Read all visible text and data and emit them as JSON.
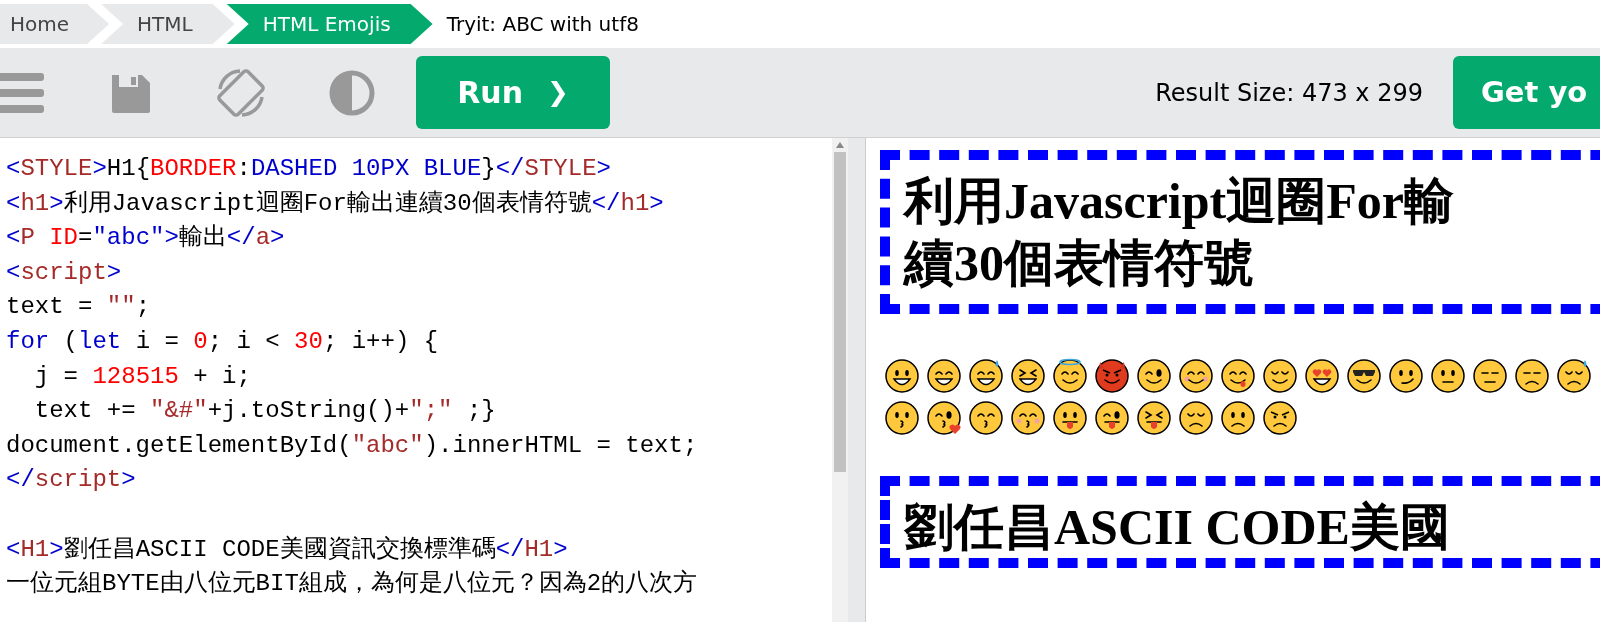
{
  "breadcrumbs": [
    {
      "label": "Home",
      "selected": false
    },
    {
      "label": "HTML",
      "selected": false
    },
    {
      "label": "HTML Emojis",
      "selected": true
    }
  ],
  "page_title": "Tryit: ABC with utf8",
  "toolbar": {
    "run_button": "Run",
    "run_icon": "❯",
    "result_size": "Result Size: 473 x 299",
    "get_button": "Get yo"
  },
  "code_lines": [
    {
      "tokens": [
        {
          "text": "<",
          "kind": "tag"
        },
        {
          "text": "STYLE",
          "kind": "name"
        },
        {
          "text": ">",
          "kind": "tag"
        },
        {
          "text": "H1{",
          "kind": "plain"
        },
        {
          "text": "BORDER",
          "kind": "attr"
        },
        {
          "text": ":",
          "kind": "plain"
        },
        {
          "text": "DASHED 10PX BLUE",
          "kind": "value"
        },
        {
          "text": "}",
          "kind": "plain"
        },
        {
          "text": "</",
          "kind": "tag"
        },
        {
          "text": "STYLE",
          "kind": "name"
        },
        {
          "text": ">",
          "kind": "tag"
        }
      ]
    },
    {
      "tokens": [
        {
          "text": "<",
          "kind": "tag"
        },
        {
          "text": "h1",
          "kind": "name"
        },
        {
          "text": ">",
          "kind": "tag"
        },
        {
          "text": "利用Javascript迴圈For輸出連續30個表情符號",
          "kind": "plain"
        },
        {
          "text": "</",
          "kind": "tag"
        },
        {
          "text": "h1",
          "kind": "name"
        },
        {
          "text": ">",
          "kind": "tag"
        }
      ]
    },
    {
      "tokens": [
        {
          "text": "<",
          "kind": "tag"
        },
        {
          "text": "P ",
          "kind": "name"
        },
        {
          "text": "ID",
          "kind": "attr"
        },
        {
          "text": "=",
          "kind": "plain"
        },
        {
          "text": "\"abc\"",
          "kind": "value"
        },
        {
          "text": ">",
          "kind": "tag"
        },
        {
          "text": "輸出",
          "kind": "plain"
        },
        {
          "text": "</",
          "kind": "tag"
        },
        {
          "text": "a",
          "kind": "name"
        },
        {
          "text": ">",
          "kind": "tag"
        }
      ]
    },
    {
      "tokens": [
        {
          "text": "<",
          "kind": "tag"
        },
        {
          "text": "script",
          "kind": "name"
        },
        {
          "text": ">",
          "kind": "tag"
        }
      ]
    },
    {
      "tokens": [
        {
          "text": "text = ",
          "kind": "plain"
        },
        {
          "text": "\"\"",
          "kind": "string"
        },
        {
          "text": ";",
          "kind": "plain"
        }
      ]
    },
    {
      "tokens": [
        {
          "text": "for",
          "kind": "keyword"
        },
        {
          "text": " (",
          "kind": "plain"
        },
        {
          "text": "let",
          "kind": "keyword"
        },
        {
          "text": " i = ",
          "kind": "plain"
        },
        {
          "text": "0",
          "kind": "number"
        },
        {
          "text": "; i < ",
          "kind": "plain"
        },
        {
          "text": "30",
          "kind": "number"
        },
        {
          "text": "; i++) {",
          "kind": "plain"
        }
      ]
    },
    {
      "tokens": [
        {
          "text": "  j = ",
          "kind": "plain"
        },
        {
          "text": "128515",
          "kind": "number"
        },
        {
          "text": " + i;",
          "kind": "plain"
        }
      ]
    },
    {
      "tokens": [
        {
          "text": "  text += ",
          "kind": "plain"
        },
        {
          "text": "\"&#\"",
          "kind": "string"
        },
        {
          "text": "+j.toString()+",
          "kind": "plain"
        },
        {
          "text": "\";\"",
          "kind": "string"
        },
        {
          "text": " ;}",
          "kind": "plain"
        }
      ]
    },
    {
      "tokens": [
        {
          "text": "document.getElementById(",
          "kind": "plain"
        },
        {
          "text": "\"abc\"",
          "kind": "string"
        },
        {
          "text": ").innerHTML = text;",
          "kind": "plain"
        }
      ]
    },
    {
      "tokens": [
        {
          "text": "</",
          "kind": "tag"
        },
        {
          "text": "script",
          "kind": "name"
        },
        {
          "text": ">",
          "kind": "tag"
        }
      ]
    },
    {
      "spaced": true,
      "tokens": [
        {
          "text": "<",
          "kind": "tag"
        },
        {
          "text": "H1",
          "kind": "name"
        },
        {
          "text": ">",
          "kind": "tag"
        },
        {
          "text": "劉任昌ASCII CODE美國資訊交換標準碼",
          "kind": "plain"
        },
        {
          "text": "</",
          "kind": "tag"
        },
        {
          "text": "H1",
          "kind": "name"
        },
        {
          "text": ">",
          "kind": "tag"
        }
      ]
    },
    {
      "tokens": [
        {
          "text": "一位元組BYTE由八位元BIT組成，為何是八位元？因為2的八次方",
          "kind": "plain"
        }
      ]
    }
  ],
  "result": {
    "heading_1": [
      "利用Javascript迴圈For輸",
      "續30個表情符號"
    ],
    "emoji_rows": [
      [
        {
          "kind": "grin"
        },
        {
          "kind": "smile"
        },
        {
          "kind": "sweat"
        },
        {
          "kind": "laugh"
        },
        {
          "kind": "halo"
        },
        {
          "kind": "devil"
        },
        {
          "kind": "wink"
        },
        {
          "kind": "blush"
        },
        {
          "kind": "yum"
        },
        {
          "kind": "relieved"
        },
        {
          "kind": "hearts"
        },
        {
          "kind": "sunglasses"
        },
        {
          "kind": "smirk"
        },
        {
          "kind": "neutral"
        },
        {
          "kind": "expressionless"
        },
        {
          "kind": "unamused"
        },
        {
          "kind": "downcast"
        }
      ],
      [
        {
          "kind": "kissing"
        },
        {
          "kind": "kissheart"
        },
        {
          "kind": "kisssmile"
        },
        {
          "kind": "kissblush"
        },
        {
          "kind": "tongue"
        },
        {
          "kind": "tonguewink"
        },
        {
          "kind": "tongueclosed"
        },
        {
          "kind": "disappointed"
        },
        {
          "kind": "worried"
        },
        {
          "kind": "angry"
        }
      ]
    ],
    "heading_2": [
      "劉任昌ASCII CODE美國"
    ]
  }
}
